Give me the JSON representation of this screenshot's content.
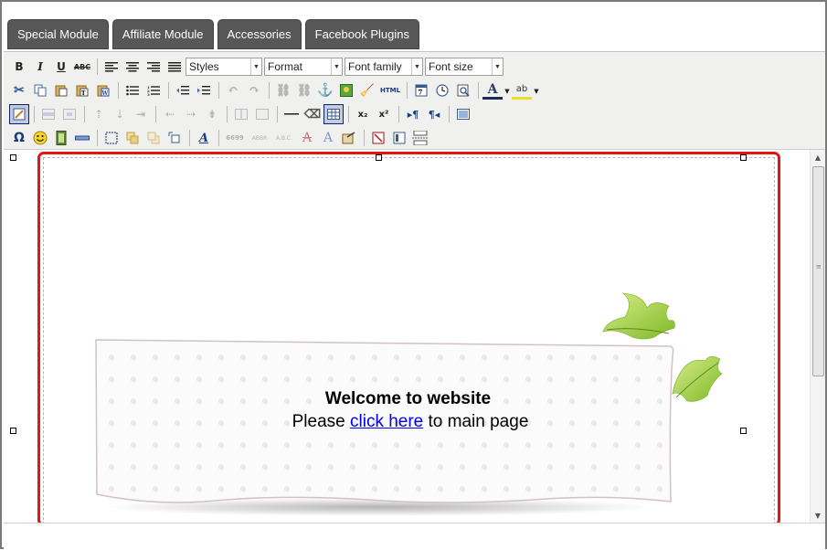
{
  "top_buttons": [
    "Special Module",
    "Affiliate Module",
    "Accessories",
    "Facebook Plugins"
  ],
  "toolbar": {
    "bold": "B",
    "italic": "I",
    "underline": "U",
    "strikethrough": "ABC",
    "styles": "Styles",
    "format": "Format",
    "font_family": "Font family",
    "font_size": "Font size",
    "html": "HTML",
    "special_char": "Ω",
    "subscript": "x₂",
    "superscript": "x²",
    "quote_glyph": "6699",
    "abbr": "ABBR",
    "acronym": "A.B.C."
  },
  "banner": {
    "welcome": "Welcome to website",
    "please": "Please",
    "link": "click here",
    "rest": "to main page"
  },
  "colors": {
    "tab_bg": "#575757",
    "selection_border": "#e81414",
    "link": "#0000ee",
    "leaf": "#9ccc3a"
  }
}
